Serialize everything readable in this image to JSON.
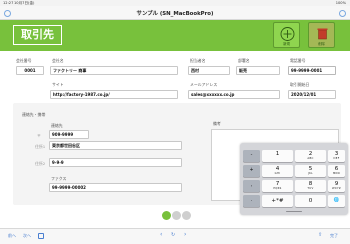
{
  "status_bar": {
    "time": "12:27",
    "date": "10月7日(金)",
    "battery": "100%"
  },
  "nav": {
    "title": "サンプル (SN_MacBookPro)",
    "left_icon": "settings-icon",
    "right_icon": "search-icon"
  },
  "header": {
    "title": "取引先",
    "new_label": "新規",
    "delete_label": "削除",
    "accent_color": "#78c13c"
  },
  "form": {
    "company_no": {
      "label": "会社番号",
      "value": "0001"
    },
    "company_name": {
      "label": "会社名",
      "value": "ファクトリー 商事"
    },
    "contact_person": {
      "label": "担当者名",
      "value": "西村"
    },
    "department": {
      "label": "部署名",
      "value": "販売"
    },
    "phone": {
      "label": "電話番号",
      "value": "99-9999-0001"
    },
    "site": {
      "label": "サイト",
      "value": "http://factory-1987.co.jp/"
    },
    "email": {
      "label": "メールアドレス",
      "value": "sales@xxxxxx.co.jp"
    },
    "start_date": {
      "label": "取引開始日",
      "value": "2020/12/01"
    }
  },
  "contact": {
    "section_label": "連絡先・携帯",
    "contact_label": "連絡先",
    "tel_label": "〒",
    "tel_value": "909-9999",
    "address1_label": "住所1",
    "address1_value": "東京都世田谷区",
    "address2_label": "住所2",
    "address2_value": "9-9-9",
    "fax_label": "ファクス",
    "fax_value": "99-9999-00002",
    "memo_label": "備考"
  },
  "keypad": {
    "rows": [
      [
        {
          "side": "-"
        },
        {
          "digit": "1",
          "letters": ""
        },
        {
          "digit": "2",
          "letters": "ABC"
        },
        {
          "digit": "3",
          "letters": "DEF"
        },
        {
          "side": "⌫"
        }
      ],
      [
        {
          "side": "+"
        },
        {
          "digit": "4",
          "letters": "GHI"
        },
        {
          "digit": "5",
          "letters": "JKL"
        },
        {
          "digit": "6",
          "letters": "MNO"
        },
        {
          "side": "␣"
        }
      ],
      [
        {
          "side": ","
        },
        {
          "digit": "7",
          "letters": "PQRS"
        },
        {
          "digit": "8",
          "letters": "TUV"
        },
        {
          "digit": "9",
          "letters": "WXYZ"
        },
        {
          "side": "↵"
        }
      ],
      [
        {
          "side": "."
        },
        {
          "digit": "+*#",
          "letters": ""
        },
        {
          "digit": "0",
          "letters": ""
        },
        {
          "digit": "🌐",
          "letters": ""
        },
        {
          "side": ""
        }
      ]
    ]
  },
  "pagination": {
    "current_page": 1,
    "total_pages": 3
  },
  "toolbar": {
    "prev_label": "前へ",
    "next_label": "次へ",
    "list_icon": "list-icon",
    "nav_back_icon": "chevron-left-icon",
    "nav_forward_icon": "chevron-right-icon",
    "sync_icon": "refresh-icon",
    "share_icon": "share-icon",
    "done_label": "完了"
  }
}
